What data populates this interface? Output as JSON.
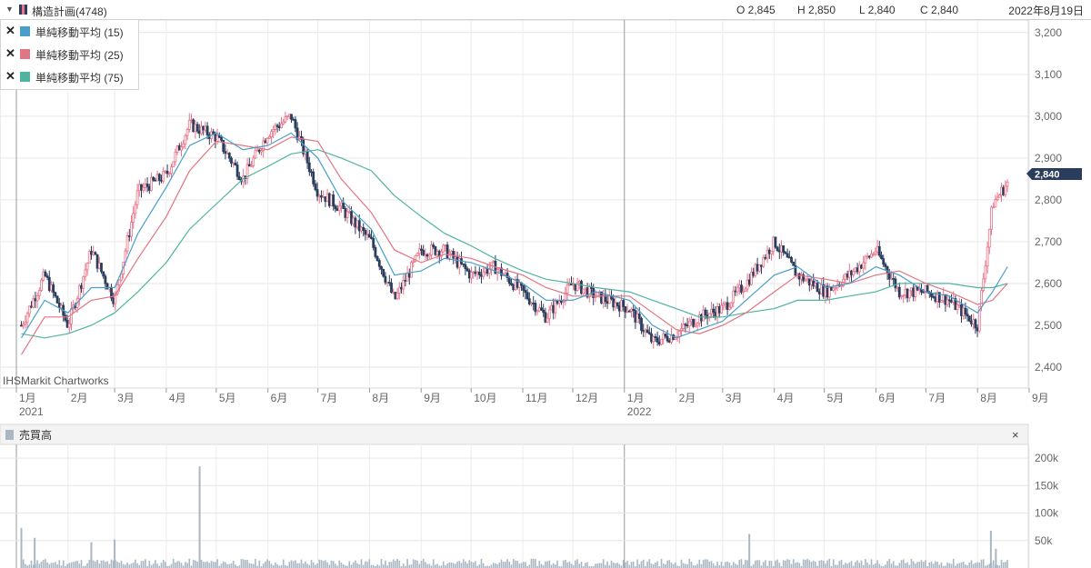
{
  "header": {
    "symbol_label": "構造計画(4748)",
    "open": "O 2,845",
    "high": "H 2,850",
    "low": "L 2,840",
    "close": "C 2,840",
    "date": "2022年8月19日"
  },
  "legend": [
    {
      "label": "単純移動平均 (15)",
      "color": "#4a9ec9"
    },
    {
      "label": "単純移動平均 (25)",
      "color": "#e07583"
    },
    {
      "label": "単純移動平均 (75)",
      "color": "#4fb3a1"
    }
  ],
  "watermark": "IHSMarkit Chartworks",
  "volume_panel": {
    "title": "売買高",
    "close_symbol": "×",
    "y_ticks": [
      "200k",
      "150k",
      "100k",
      "50k"
    ]
  },
  "colors": {
    "up": "#e9748a",
    "down": "#2b3d5c",
    "ma15": "#4a9ec9",
    "ma25": "#e07583",
    "ma75": "#4fb3a1",
    "volume": "#a9b7c3"
  },
  "chart_data": {
    "type": "line",
    "price_axis": {
      "ticks": [
        "3,200",
        "3,100",
        "3,000",
        "2,900",
        "2,800",
        "2,700",
        "2,600",
        "2,500",
        "2,400"
      ],
      "ylim": [
        2350,
        3230
      ]
    },
    "last_price": "2,840",
    "x_axis": {
      "months": [
        "1月",
        "2月",
        "3月",
        "4月",
        "5月",
        "6月",
        "7月",
        "8月",
        "9月",
        "10月",
        "11月",
        "12月",
        "1月",
        "2月",
        "3月",
        "4月",
        "5月",
        "6月",
        "7月",
        "8月",
        "9月"
      ],
      "year_labels": [
        "2021",
        "2022"
      ]
    },
    "price_series": {
      "x": [
        "2021-01-04",
        "2021-01-18",
        "2021-02-01",
        "2021-02-15",
        "2021-03-01",
        "2021-03-15",
        "2021-04-01",
        "2021-04-15",
        "2021-05-01",
        "2021-05-17",
        "2021-06-01",
        "2021-06-15",
        "2021-07-01",
        "2021-07-15",
        "2021-08-02",
        "2021-08-16",
        "2021-09-01",
        "2021-09-15",
        "2021-10-01",
        "2021-10-15",
        "2021-11-01",
        "2021-11-15",
        "2021-12-01",
        "2021-12-15",
        "2022-01-04",
        "2022-01-18",
        "2022-02-01",
        "2022-02-15",
        "2022-03-01",
        "2022-03-15",
        "2022-04-01",
        "2022-04-15",
        "2022-05-02",
        "2022-05-16",
        "2022-06-01",
        "2022-06-15",
        "2022-07-01",
        "2022-07-15",
        "2022-08-01",
        "2022-08-10",
        "2022-08-19"
      ],
      "close": [
        2500,
        2620,
        2500,
        2680,
        2560,
        2820,
        2860,
        2980,
        2950,
        2850,
        2960,
        3000,
        2820,
        2780,
        2700,
        2560,
        2680,
        2680,
        2620,
        2640,
        2580,
        2520,
        2600,
        2570,
        2540,
        2460,
        2480,
        2520,
        2540,
        2600,
        2700,
        2620,
        2580,
        2620,
        2680,
        2580,
        2580,
        2560,
        2500,
        2790,
        2840
      ]
    },
    "ma15": [
      2470,
      2560,
      2530,
      2590,
      2590,
      2720,
      2830,
      2930,
      2960,
      2920,
      2930,
      2960,
      2900,
      2800,
      2730,
      2620,
      2630,
      2660,
      2650,
      2630,
      2600,
      2560,
      2560,
      2580,
      2560,
      2500,
      2470,
      2490,
      2510,
      2560,
      2620,
      2640,
      2590,
      2600,
      2640,
      2620,
      2580,
      2570,
      2530,
      2580,
      2640
    ],
    "ma25": [
      2430,
      2520,
      2520,
      2560,
      2570,
      2660,
      2760,
      2870,
      2940,
      2930,
      2920,
      2950,
      2940,
      2850,
      2770,
      2680,
      2650,
      2670,
      2660,
      2640,
      2620,
      2590,
      2570,
      2570,
      2570,
      2530,
      2490,
      2480,
      2500,
      2530,
      2580,
      2620,
      2610,
      2600,
      2620,
      2630,
      2600,
      2580,
      2550,
      2560,
      2600
    ],
    "ma75": [
      2480,
      2470,
      2480,
      2500,
      2530,
      2580,
      2650,
      2730,
      2790,
      2850,
      2880,
      2910,
      2920,
      2900,
      2870,
      2810,
      2760,
      2720,
      2690,
      2660,
      2630,
      2610,
      2600,
      2590,
      2580,
      2560,
      2540,
      2520,
      2520,
      2530,
      2540,
      2560,
      2560,
      2570,
      2580,
      2600,
      2600,
      2600,
      2590,
      2590,
      2600
    ],
    "volume_axis": {
      "ticks": [
        "200k",
        "150k",
        "100k",
        "50k"
      ],
      "ylim": [
        0,
        225000
      ]
    },
    "volume_x": [
      "2021-01-04",
      "2021-01-12",
      "2021-02-15",
      "2021-03-01",
      "2021-04-21",
      "2022-03-17",
      "2022-08-09",
      "2022-08-12"
    ],
    "volume": [
      73000,
      55000,
      47000,
      52000,
      185000,
      62000,
      68000,
      35000
    ]
  }
}
